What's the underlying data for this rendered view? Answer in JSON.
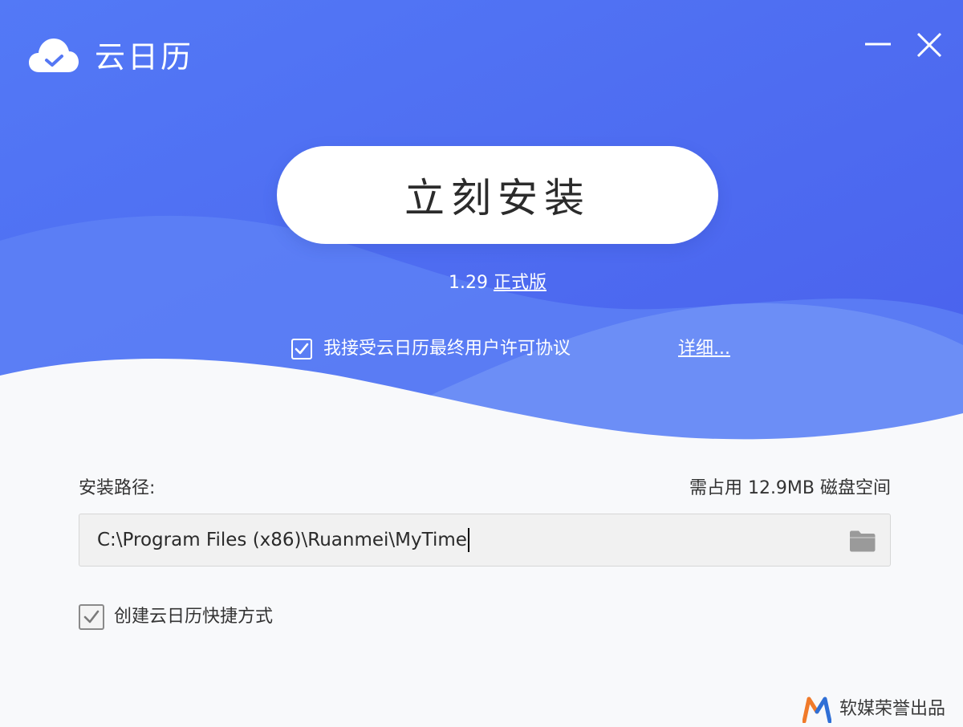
{
  "app": {
    "title": "云日历"
  },
  "window_controls": {
    "minimize_icon": "minimize-icon",
    "close_icon": "close-icon"
  },
  "install": {
    "button_label": "立刻安装",
    "version": "1.29",
    "edition": "正式版"
  },
  "agreement": {
    "checked": true,
    "text": "我接受云日历最终用户许可协议",
    "details_link": "详细..."
  },
  "path_section": {
    "label": "安装路径:",
    "space_required": "需占用 12.9MB 磁盘空间",
    "path_value": "C:\\Program Files (x86)\\Ruanmei\\MyTime",
    "browse_icon": "folder-icon"
  },
  "shortcut": {
    "checked": true,
    "label": "创建云日历快捷方式"
  },
  "footer": {
    "brand_text": "软媒荣誉出品"
  },
  "colors": {
    "hero_gradient_start": "#4f75f5",
    "hero_gradient_end": "#4c63ee",
    "background": "#f8f9fb",
    "brand_orange": "#f07a2a",
    "brand_blue": "#2f6fd6"
  }
}
